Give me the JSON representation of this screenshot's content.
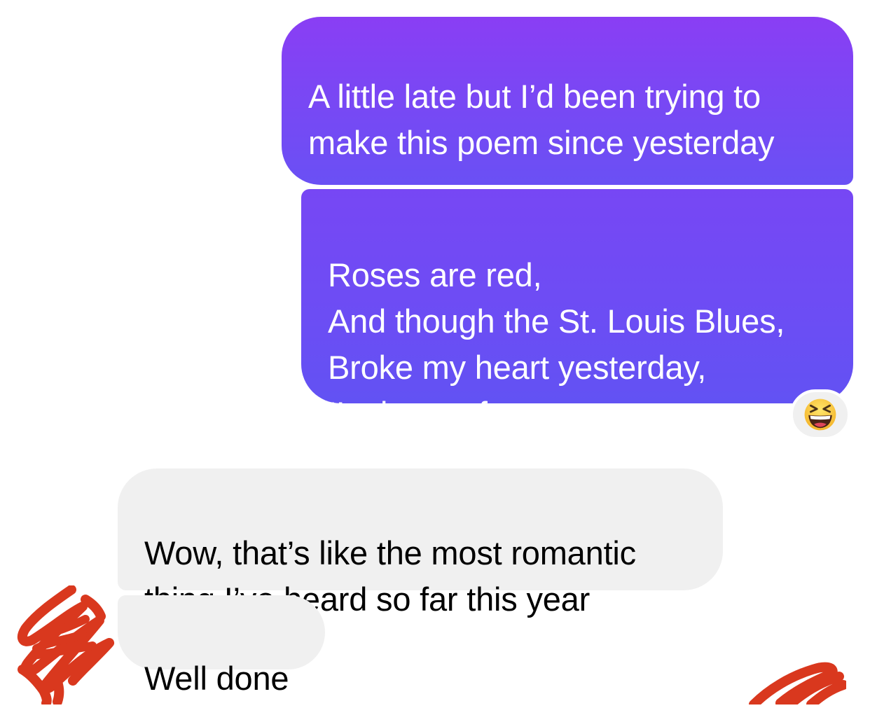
{
  "conversation": {
    "messages": [
      {
        "side": "sent",
        "text": "A little late but I’d been trying to\nmake this poem since yesterday",
        "emoji": "😆"
      },
      {
        "side": "sent",
        "text": "Roses are red,\nAnd though the St. Louis Blues,\nBroke my heart yesterday,\nI’m happy for you."
      },
      {
        "side": "received",
        "text": "Wow, that’s like the most romantic\nthing I’ve heard so far this year"
      },
      {
        "side": "received",
        "text": "Well done"
      }
    ],
    "reaction": {
      "emoji": "😆",
      "icon": "laughing-face-icon"
    }
  },
  "colors": {
    "sent_bubble_top": "#8a3ef4",
    "sent_bubble_bottom": "#6252f3",
    "received_bubble": "#f0f0f0",
    "redaction": "#d9381e"
  }
}
